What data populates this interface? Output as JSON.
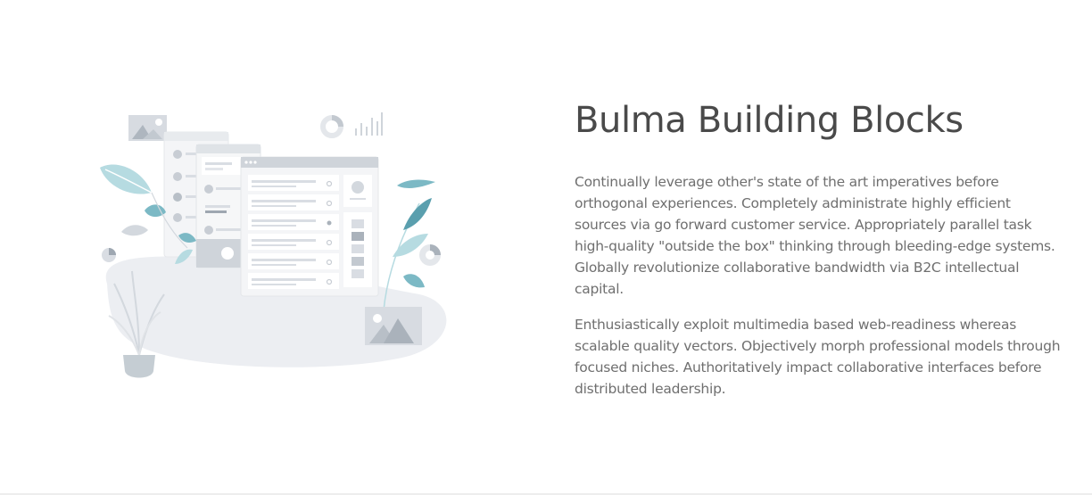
{
  "section": {
    "title": "Bulma Building Blocks",
    "paragraphs": [
      "Continually leverage other's state of the art imperatives before orthogonal experiences. Completely administrate highly efficient sources via go forward customer service. Appropriately parallel task high-quality \"outside the box\" thinking through bleeding-edge systems. Globally revolutionize collaborative bandwidth via B2C intellectual capital.",
      "Enthusiastically exploit multimedia based web-readiness whereas scalable quality vectors. Objectively morph professional models through focused niches. Authoritatively impact collaborative interfaces before distributed leadership."
    ]
  },
  "illustration": {
    "icon": "dashboard-illustration",
    "colors": {
      "blob": "#eceef2",
      "card": "#f4f5f7",
      "card_header": "#cfd4da",
      "line": "#d9dde3",
      "accent_teal": "#7cb9c5",
      "accent_light": "#b6dbe1",
      "pot": "#c5cdd3"
    }
  }
}
